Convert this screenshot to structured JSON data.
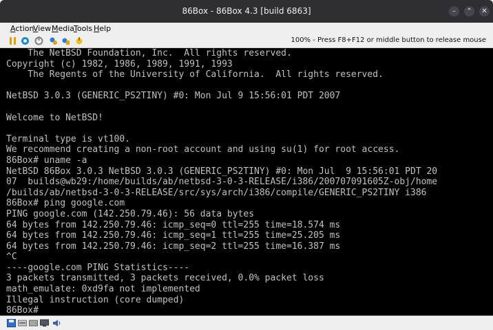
{
  "window": {
    "title": "86Box - 86Box 4.3 [build 6863]"
  },
  "titlebar_buttons": {
    "minimize": "–",
    "maximize": "⌃",
    "close": "✕"
  },
  "menu": {
    "items": [
      {
        "label": "Action",
        "mnemonic": "A",
        "rest": "ction"
      },
      {
        "label": "View",
        "mnemonic": "V",
        "rest": "iew"
      },
      {
        "label": "Media",
        "mnemonic": "M",
        "rest": "edia"
      },
      {
        "label": "Tools",
        "mnemonic": "T",
        "rest": "ools"
      },
      {
        "label": "Help",
        "mnemonic": "H",
        "rest": "elp"
      }
    ]
  },
  "toolbar": {
    "status_text": "100% - Press F8+F12 or middle button to release mouse",
    "icons": [
      "pause-icon",
      "ctrl-alt-del-icon",
      "reset-icon",
      "settings-icon",
      "ctrl-alt-esc-icon",
      "acpi-shutdown-icon"
    ]
  },
  "terminal": {
    "lines": [
      "    The NetBSD Foundation, Inc.  All rights reserved.",
      "Copyright (c) 1982, 1986, 1989, 1991, 1993",
      "    The Regents of the University of California.  All rights reserved.",
      "",
      "NetBSD 3.0.3 (GENERIC_PS2TINY) #0: Mon Jul 9 15:56:01 PDT 2007",
      "",
      "Welcome to NetBSD!",
      "",
      "Terminal type is vt100.",
      "We recommend creating a non-root account and using su(1) for root access.",
      "86Box# uname -a",
      "NetBSD 86Box 3.0.3 NetBSD 3.0.3 (GENERIC_PS2TINY) #0: Mon Jul  9 15:56:01 PDT 20",
      "07  builds@wb29:/home/builds/ab/netbsd-3-0-3-RELEASE/i386/200707091605Z-obj/home",
      "/builds/ab/netbsd-3-0-3-RELEASE/src/sys/arch/i386/compile/GENERIC_PS2TINY i386",
      "86Box# ping google.com",
      "PING google.com (142.250.79.46): 56 data bytes",
      "64 bytes from 142.250.79.46: icmp_seq=0 ttl=255 time=18.574 ms",
      "64 bytes from 142.250.79.46: icmp_seq=1 ttl=255 time=25.205 ms",
      "64 bytes from 142.250.79.46: icmp_seq=2 ttl=255 time=16.387 ms",
      "^C",
      "----google.com PING Statistics----",
      "3 packets transmitted, 3 packets received, 0.0% packet loss",
      "math_emulate: 0xd9fa not implemented",
      "Illegal instruction (core dumped)",
      "86Box#"
    ]
  },
  "statusbar": {
    "icons": [
      "floppy-drive-icon",
      "cdrom-drive-icon",
      "hard-disk-icon",
      "network-icon",
      "sound-icon"
    ]
  },
  "colors": {
    "titlebar": "#2e2e33",
    "terminal_bg": "#000000",
    "terminal_fg": "#c0c0c0"
  }
}
